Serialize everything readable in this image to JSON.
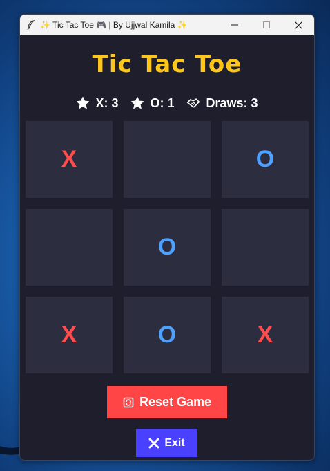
{
  "window": {
    "title": "✨ Tic Tac Toe 🎮 | By Ujjwal Kamila ✨",
    "app_icon": "feather-icon",
    "controls": [
      "minimize-icon",
      "maximize-icon",
      "close-icon"
    ]
  },
  "game": {
    "title": "Tic Tac Toe",
    "title_color": "#ffc61a"
  },
  "scores": {
    "x_label": "X: 3",
    "o_label": "O: 1",
    "draws_label": "Draws: 3",
    "x_icon": "star-icon",
    "o_icon": "star-icon",
    "draws_icon": "handshake-icon"
  },
  "board": {
    "cells": [
      "X",
      "",
      "O",
      "",
      "O",
      "",
      "X",
      "O",
      "X"
    ],
    "x_color": "#ff4c4c",
    "o_color": "#4ea1ff",
    "cell_color": "#2d2d40"
  },
  "buttons": {
    "reset_label": "Reset Game",
    "reset_icon": "reset-icon",
    "reset_color": "#ff4545",
    "exit_label": "Exit",
    "exit_icon": "x-mark-icon",
    "exit_color": "#4a40ff"
  }
}
